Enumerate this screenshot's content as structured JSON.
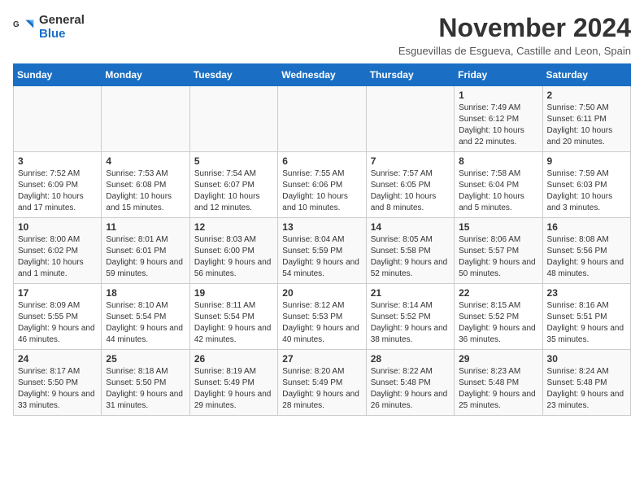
{
  "logo": {
    "line1": "General",
    "line2": "Blue"
  },
  "title": "November 2024",
  "subtitle": "Esguevillas de Esgueva, Castille and Leon, Spain",
  "days_header": [
    "Sunday",
    "Monday",
    "Tuesday",
    "Wednesday",
    "Thursday",
    "Friday",
    "Saturday"
  ],
  "weeks": [
    [
      {
        "day": "",
        "info": ""
      },
      {
        "day": "",
        "info": ""
      },
      {
        "day": "",
        "info": ""
      },
      {
        "day": "",
        "info": ""
      },
      {
        "day": "",
        "info": ""
      },
      {
        "day": "1",
        "info": "Sunrise: 7:49 AM\nSunset: 6:12 PM\nDaylight: 10 hours and 22 minutes."
      },
      {
        "day": "2",
        "info": "Sunrise: 7:50 AM\nSunset: 6:11 PM\nDaylight: 10 hours and 20 minutes."
      }
    ],
    [
      {
        "day": "3",
        "info": "Sunrise: 7:52 AM\nSunset: 6:09 PM\nDaylight: 10 hours and 17 minutes."
      },
      {
        "day": "4",
        "info": "Sunrise: 7:53 AM\nSunset: 6:08 PM\nDaylight: 10 hours and 15 minutes."
      },
      {
        "day": "5",
        "info": "Sunrise: 7:54 AM\nSunset: 6:07 PM\nDaylight: 10 hours and 12 minutes."
      },
      {
        "day": "6",
        "info": "Sunrise: 7:55 AM\nSunset: 6:06 PM\nDaylight: 10 hours and 10 minutes."
      },
      {
        "day": "7",
        "info": "Sunrise: 7:57 AM\nSunset: 6:05 PM\nDaylight: 10 hours and 8 minutes."
      },
      {
        "day": "8",
        "info": "Sunrise: 7:58 AM\nSunset: 6:04 PM\nDaylight: 10 hours and 5 minutes."
      },
      {
        "day": "9",
        "info": "Sunrise: 7:59 AM\nSunset: 6:03 PM\nDaylight: 10 hours and 3 minutes."
      }
    ],
    [
      {
        "day": "10",
        "info": "Sunrise: 8:00 AM\nSunset: 6:02 PM\nDaylight: 10 hours and 1 minute."
      },
      {
        "day": "11",
        "info": "Sunrise: 8:01 AM\nSunset: 6:01 PM\nDaylight: 9 hours and 59 minutes."
      },
      {
        "day": "12",
        "info": "Sunrise: 8:03 AM\nSunset: 6:00 PM\nDaylight: 9 hours and 56 minutes."
      },
      {
        "day": "13",
        "info": "Sunrise: 8:04 AM\nSunset: 5:59 PM\nDaylight: 9 hours and 54 minutes."
      },
      {
        "day": "14",
        "info": "Sunrise: 8:05 AM\nSunset: 5:58 PM\nDaylight: 9 hours and 52 minutes."
      },
      {
        "day": "15",
        "info": "Sunrise: 8:06 AM\nSunset: 5:57 PM\nDaylight: 9 hours and 50 minutes."
      },
      {
        "day": "16",
        "info": "Sunrise: 8:08 AM\nSunset: 5:56 PM\nDaylight: 9 hours and 48 minutes."
      }
    ],
    [
      {
        "day": "17",
        "info": "Sunrise: 8:09 AM\nSunset: 5:55 PM\nDaylight: 9 hours and 46 minutes."
      },
      {
        "day": "18",
        "info": "Sunrise: 8:10 AM\nSunset: 5:54 PM\nDaylight: 9 hours and 44 minutes."
      },
      {
        "day": "19",
        "info": "Sunrise: 8:11 AM\nSunset: 5:54 PM\nDaylight: 9 hours and 42 minutes."
      },
      {
        "day": "20",
        "info": "Sunrise: 8:12 AM\nSunset: 5:53 PM\nDaylight: 9 hours and 40 minutes."
      },
      {
        "day": "21",
        "info": "Sunrise: 8:14 AM\nSunset: 5:52 PM\nDaylight: 9 hours and 38 minutes."
      },
      {
        "day": "22",
        "info": "Sunrise: 8:15 AM\nSunset: 5:52 PM\nDaylight: 9 hours and 36 minutes."
      },
      {
        "day": "23",
        "info": "Sunrise: 8:16 AM\nSunset: 5:51 PM\nDaylight: 9 hours and 35 minutes."
      }
    ],
    [
      {
        "day": "24",
        "info": "Sunrise: 8:17 AM\nSunset: 5:50 PM\nDaylight: 9 hours and 33 minutes."
      },
      {
        "day": "25",
        "info": "Sunrise: 8:18 AM\nSunset: 5:50 PM\nDaylight: 9 hours and 31 minutes."
      },
      {
        "day": "26",
        "info": "Sunrise: 8:19 AM\nSunset: 5:49 PM\nDaylight: 9 hours and 29 minutes."
      },
      {
        "day": "27",
        "info": "Sunrise: 8:20 AM\nSunset: 5:49 PM\nDaylight: 9 hours and 28 minutes."
      },
      {
        "day": "28",
        "info": "Sunrise: 8:22 AM\nSunset: 5:48 PM\nDaylight: 9 hours and 26 minutes."
      },
      {
        "day": "29",
        "info": "Sunrise: 8:23 AM\nSunset: 5:48 PM\nDaylight: 9 hours and 25 minutes."
      },
      {
        "day": "30",
        "info": "Sunrise: 8:24 AM\nSunset: 5:48 PM\nDaylight: 9 hours and 23 minutes."
      }
    ]
  ]
}
